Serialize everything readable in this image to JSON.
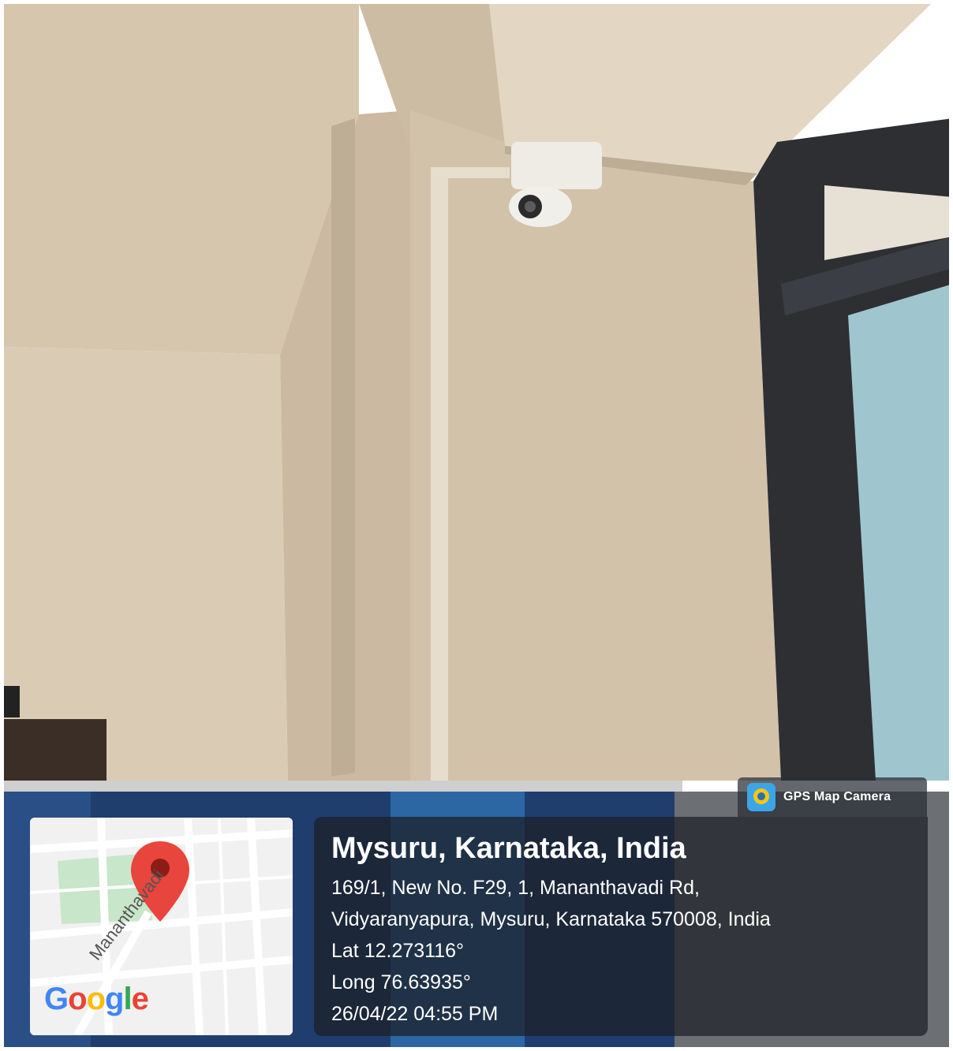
{
  "overlay": {
    "app_badge": "GPS Map Camera",
    "location_title": "Mysuru, Karnataka, India",
    "address_line1": "169/1, New No. F29, 1, Mananthavadi Rd,",
    "address_line2": "Vidyaranyapura, Mysuru, Karnataka 570008, India",
    "latitude": "Lat 12.273116°",
    "longitude": "Long 76.63935°",
    "datetime": "26/04/22 04:55 PM"
  },
  "map": {
    "street_name": "Mananthavadi",
    "logo": "Google"
  },
  "colors": {
    "wall": "#cdbda6",
    "ceiling": "#d9cab4",
    "banner_blue": "#1b3a6b",
    "pin_red": "#e8453c"
  }
}
